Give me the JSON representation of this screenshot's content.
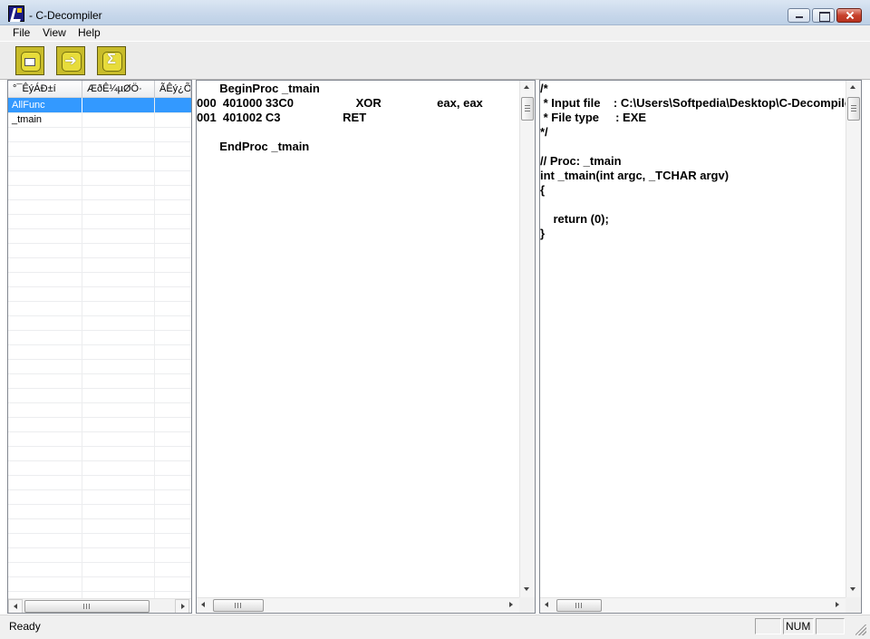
{
  "window": {
    "title": "- C-Decompiler"
  },
  "menu": {
    "file": "File",
    "view": "View",
    "help": "Help"
  },
  "toolbar": {
    "buttons": [
      {
        "icon": "open-folder-icon"
      },
      {
        "icon": "arrow-right-icon"
      },
      {
        "icon": "sigma-document-icon"
      }
    ]
  },
  "function_list": {
    "columns": [
      "°¯ÊýÁÐ±í",
      "ÆðÊ¼µØÖ·",
      "ÃÊý¿ÕÊ"
    ],
    "rows": [
      "AllFunc",
      "_tmain"
    ],
    "selected_index": 0
  },
  "disassembly": {
    "lines": [
      {
        "text": "       BeginProc _tmain"
      },
      {
        "text": "000  401000 33C0                   XOR                 eax, eax"
      },
      {
        "text": "001  401002 C3                   RET"
      },
      {
        "text": ""
      },
      {
        "text": "       EndProc _tmain"
      }
    ]
  },
  "source": {
    "lines": [
      "/*",
      " * Input file    : C:\\Users\\Softpedia\\Desktop\\C-Decompiler\\",
      " * File type     : EXE",
      "*/",
      "",
      "// Proc: _tmain",
      "int _tmain(int argc, _TCHAR argv)",
      "{",
      "",
      "    return (0);",
      "}"
    ]
  },
  "statusbar": {
    "text": "Ready",
    "panel1": "",
    "panel2": "NUM",
    "panel3": ""
  },
  "colors": {
    "selection": "#3399ff",
    "toolbar_icon": "#c8bc2a"
  }
}
